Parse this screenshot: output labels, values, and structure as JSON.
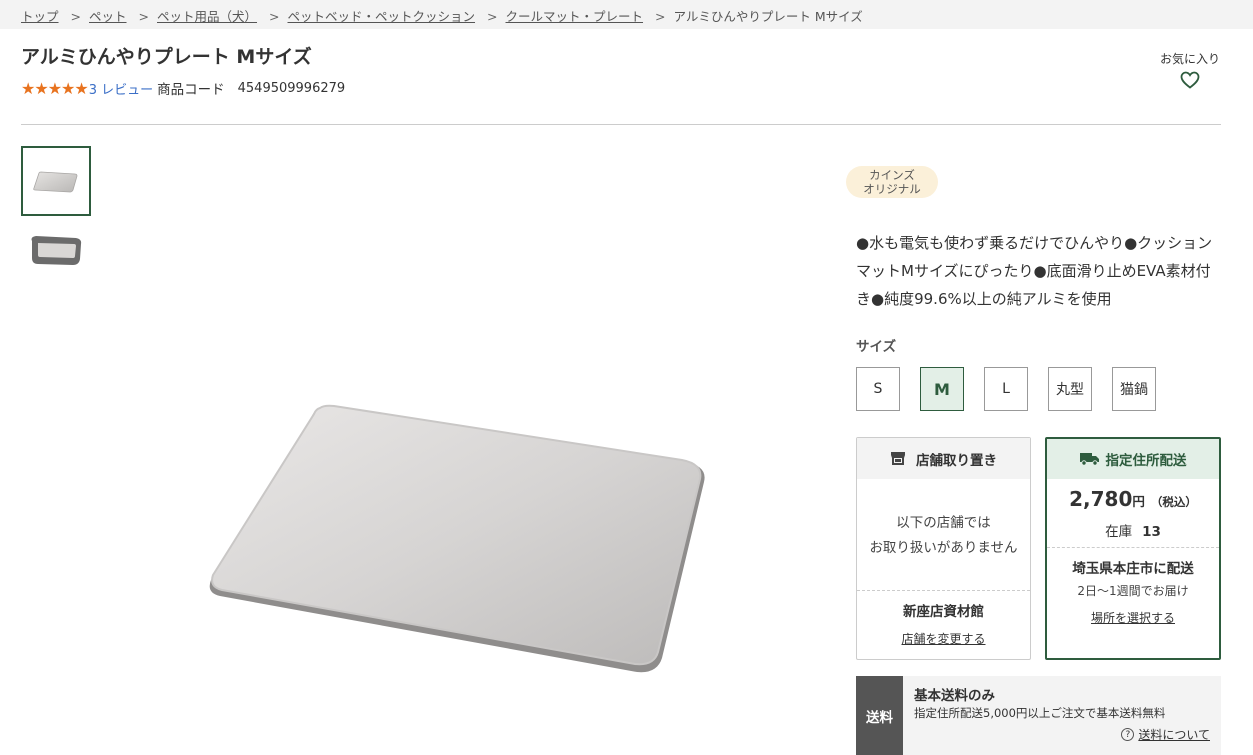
{
  "breadcrumb": {
    "items": [
      "トップ",
      "ペット",
      "ペット用品（犬）",
      "ペットベッド・ペットクッション",
      "クールマット・プレート"
    ],
    "current": "アルミひんやりプレート Mサイズ",
    "separator": ">"
  },
  "product": {
    "title": "アルミひんやりプレート Mサイズ",
    "stars": "★★★★★",
    "rating_value": 5,
    "review_text": "3 レビュー",
    "code_label": "商品コード",
    "code_value": "4549509996279"
  },
  "favorite": {
    "label": "お気に入り",
    "icon": "heart-icon"
  },
  "badge": {
    "line1": "カインズ",
    "line2": "オリジナル"
  },
  "description": "●水も電気も使わず乗るだけでひんやり●クッションマットMサイズにぴったり●底面滑り止めEVA素材付き●純度99.6%以上の純アルミを使用",
  "sizes": {
    "label": "サイズ",
    "options": [
      "S",
      "M",
      "L",
      "丸型",
      "猫鍋"
    ],
    "selected": "M"
  },
  "store_pickup": {
    "title": "店舗取り置き",
    "icon": "store-icon",
    "message_line1": "以下の店舗では",
    "message_line2": "お取り扱いがありません",
    "store_name": "新座店資材館",
    "change_link": "店舗を変更する"
  },
  "delivery": {
    "title": "指定住所配送",
    "icon": "truck-icon",
    "price": "2,780",
    "price_unit": "円",
    "tax_note": "（税込）",
    "stock_label": "在庫",
    "stock_value": "13",
    "area": "埼玉県本庄市に配送",
    "days": "2日〜1週間でお届け",
    "change_link": "場所を選択する"
  },
  "shipping": {
    "tag": "送料",
    "title": "基本送料のみ",
    "note": "指定住所配送5,000円以上ご注文で基本送料無料",
    "link": "送料について",
    "link_icon": "question-icon"
  },
  "colors": {
    "accent_green": "#2e5c3e",
    "star_orange": "#e8731f",
    "link_blue": "#3b6fc7",
    "badge_bg": "#fbf0d9"
  }
}
